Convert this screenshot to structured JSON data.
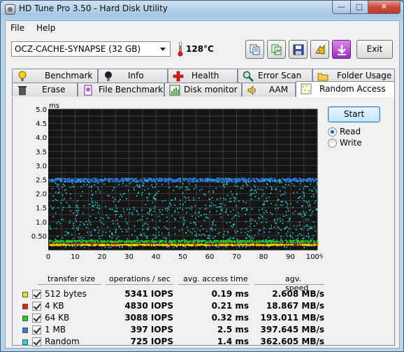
{
  "window": {
    "title": "HD Tune Pro 3.50 - Hard Disk Utility",
    "min_label": "—",
    "max_label": "□",
    "close_label": "✕"
  },
  "menu": {
    "file": "File",
    "help": "Help"
  },
  "toolbar": {
    "drive": "OCZ-CACHE-SYNAPSE (32 GB)",
    "temperature": "128°C",
    "exit_label": "Exit",
    "buttons": [
      "copy-info-icon",
      "copy-screenshot-icon",
      "save-icon",
      "settings-icon",
      "download-icon"
    ]
  },
  "tabs": {
    "row1": [
      {
        "label": "Benchmark",
        "icon": "bulb-icon"
      },
      {
        "label": "Info",
        "icon": "info-bulb-icon"
      },
      {
        "label": "Health",
        "icon": "cross-icon"
      },
      {
        "label": "Error Scan",
        "icon": "magnifier-icon"
      },
      {
        "label": "Folder Usage",
        "icon": "folder-icon"
      }
    ],
    "row2": [
      {
        "label": "Erase",
        "icon": "trash-icon"
      },
      {
        "label": "File Benchmark",
        "icon": "file-bench-icon"
      },
      {
        "label": "Disk monitor",
        "icon": "monitor-icon"
      },
      {
        "label": "AAM",
        "icon": "speaker-icon"
      },
      {
        "label": "Random Access",
        "icon": "random-icon"
      }
    ],
    "active": "Random Access"
  },
  "controls": {
    "start_label": "Start",
    "read_label": "Read",
    "write_label": "Write",
    "selected": "Read"
  },
  "chart_data": {
    "type": "scatter",
    "y_unit": "ms",
    "x_suffix": "%",
    "ylim": [
      0,
      5.0
    ],
    "xlim": [
      0,
      100
    ],
    "y_ticks": [
      "5.0",
      "4.5",
      "4.0",
      "3.5",
      "3.0",
      "2.5",
      "2.0",
      "1.5",
      "1.0",
      "0.50"
    ],
    "x_ticks": [
      "0",
      "10",
      "20",
      "30",
      "40",
      "50",
      "60",
      "70",
      "80",
      "90",
      "100%"
    ],
    "grid": true,
    "series": [
      {
        "name": "512 bytes",
        "color": "#e8e800",
        "access_ms": 0.19
      },
      {
        "name": "4 KB",
        "color": "#e82020",
        "access_ms": 0.21
      },
      {
        "name": "64 KB",
        "color": "#20d020",
        "access_ms": 0.32
      },
      {
        "name": "1 MB",
        "color": "#2f7fe8",
        "access_ms": 2.5
      },
      {
        "name": "Random",
        "color": "#20d8e0",
        "access_ms": 1.4
      }
    ]
  },
  "results": {
    "headers": {
      "size": "transfer size",
      "ops": "operations / sec",
      "access": "avg. access time",
      "speed": "agv. speed"
    },
    "rows": [
      {
        "label": "512 bytes",
        "color": "#e8e800",
        "ops": "5341 IOPS",
        "access": "0.19 ms",
        "speed": "2.608 MB/s"
      },
      {
        "label": "4 KB",
        "color": "#e82020",
        "ops": "4830 IOPS",
        "access": "0.21 ms",
        "speed": "18.867 MB/s"
      },
      {
        "label": "64 KB",
        "color": "#20d020",
        "ops": "3088 IOPS",
        "access": "0.32 ms",
        "speed": "193.011 MB/s"
      },
      {
        "label": "1 MB",
        "color": "#2f7fe8",
        "ops": "397 IOPS",
        "access": "2.5 ms",
        "speed": "397.645 MB/s"
      },
      {
        "label": "Random",
        "color": "#20d8e0",
        "ops": "725 IOPS",
        "access": "1.4 ms",
        "speed": "362.605 MB/s"
      }
    ]
  }
}
